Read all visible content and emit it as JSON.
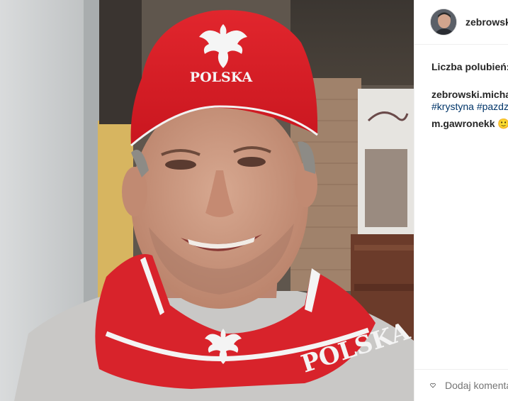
{
  "post": {
    "username": "zebrowski.michal",
    "likes_label": "Liczba polubień:",
    "caption_user": "zebrowski.michal",
    "caption_tags": [
      "#krystyna",
      "#pazdziernik"
    ],
    "comments": [
      {
        "user": "m.gawronekk",
        "text": "🙂"
      }
    ],
    "add_comment_placeholder": "Dodaj komentarz..."
  },
  "photo": {
    "cap_text": "POLSKA",
    "scarf_text": "POLSKA"
  },
  "colors": {
    "hashtag": "#003569",
    "placeholder": "#999999",
    "divider": "#efefef"
  }
}
